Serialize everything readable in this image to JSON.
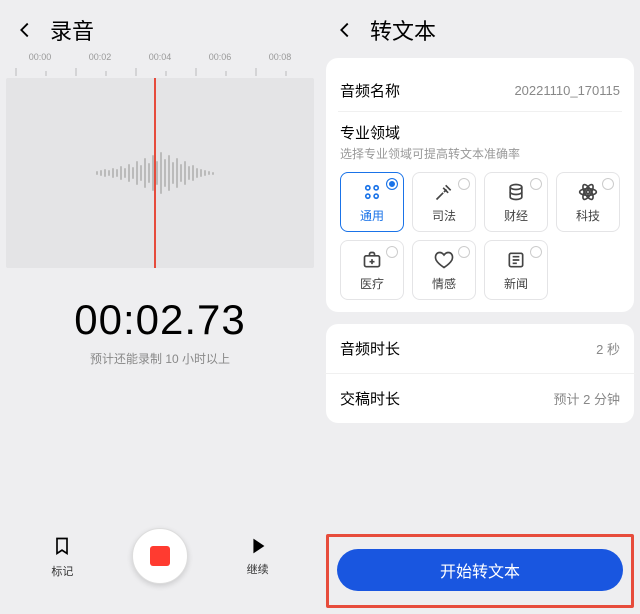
{
  "left": {
    "title": "录音",
    "ruler_labels": [
      "00:00",
      "00:02",
      "00:04",
      "00:06",
      "00:08"
    ],
    "time": "00:02.73",
    "time_sub": "预计还能录制 10 小时以上",
    "controls": {
      "bookmark": "标记",
      "continue": "继续"
    }
  },
  "right": {
    "title": "转文本",
    "audio_name_label": "音频名称",
    "audio_name_value": "20221110_170115",
    "domain_section_label": "专业领域",
    "domain_section_sub": "选择专业领域可提高转文本准确率",
    "domains": [
      {
        "label": "通用",
        "icon": "grid",
        "selected": true
      },
      {
        "label": "司法",
        "icon": "gavel",
        "selected": false
      },
      {
        "label": "财经",
        "icon": "coins",
        "selected": false
      },
      {
        "label": "科技",
        "icon": "atom",
        "selected": false
      },
      {
        "label": "医疗",
        "icon": "medkit",
        "selected": false
      },
      {
        "label": "情感",
        "icon": "heart",
        "selected": false
      },
      {
        "label": "新闻",
        "icon": "news",
        "selected": false
      }
    ],
    "audio_duration_label": "音频时长",
    "audio_duration_value": "2 秒",
    "delivery_label": "交稿时长",
    "delivery_value": "预计 2 分钟",
    "cta": "开始转文本"
  }
}
